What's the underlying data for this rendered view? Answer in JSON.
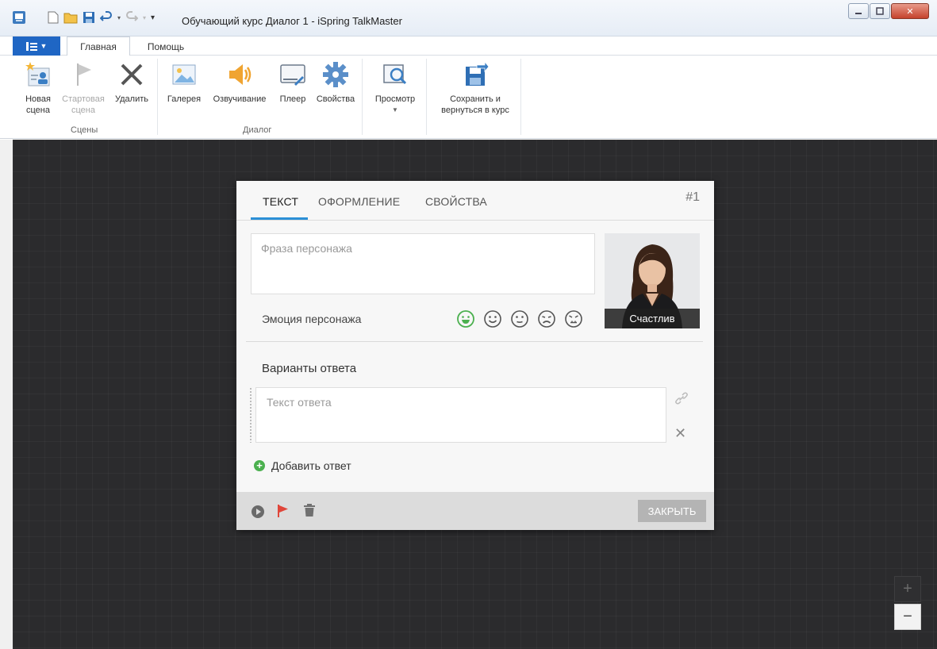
{
  "window": {
    "title": "Обучающий курс Диалог 1 - iSpring TalkMaster",
    "buttons": [
      "minimize",
      "maximize",
      "close"
    ]
  },
  "quick_access": [
    "new-file-icon",
    "open-folder-icon",
    "save-icon",
    "undo-icon",
    "redo-icon",
    "customize-icon"
  ],
  "ribbon": {
    "tabs": [
      {
        "label": "Главная",
        "active": true
      },
      {
        "label": "Помощь",
        "active": false
      }
    ],
    "groups": [
      {
        "label": "Сцены",
        "buttons": [
          {
            "line1": "Новая",
            "line2": "сцена",
            "icon": "new-scene-icon",
            "enabled": true
          },
          {
            "line1": "Стартовая",
            "line2": "сцена",
            "icon": "flag-icon",
            "enabled": false
          },
          {
            "line1": "Удалить",
            "line2": "",
            "icon": "delete-x-icon",
            "enabled": true
          }
        ]
      },
      {
        "label": "Диалог",
        "buttons": [
          {
            "line1": "Галерея",
            "icon": "gallery-icon",
            "enabled": true
          },
          {
            "line1": "Озвучивание",
            "icon": "speaker-icon",
            "enabled": true
          },
          {
            "line1": "Плеер",
            "icon": "player-icon",
            "enabled": true
          },
          {
            "line1": "Свойства",
            "icon": "gear-icon",
            "enabled": true
          }
        ]
      },
      {
        "label": "",
        "buttons": [
          {
            "line1": "Просмотр",
            "icon": "preview-icon",
            "enabled": true
          }
        ]
      },
      {
        "label": "",
        "buttons": [
          {
            "line1": "Сохранить и",
            "line2": "вернуться в курс",
            "icon": "save-return-icon",
            "enabled": true
          }
        ]
      }
    ]
  },
  "card": {
    "tabs": [
      {
        "label": "ТЕКСТ",
        "active": true
      },
      {
        "label": "ОФОРМЛЕНИЕ",
        "active": false
      },
      {
        "label": "СВОЙСТВА",
        "active": false
      }
    ],
    "number": "#1",
    "phrase_placeholder": "Фраза персонажа",
    "emotion_label": "Эмоция персонажа",
    "emotions": [
      {
        "name": "happy",
        "selected": true
      },
      {
        "name": "smile",
        "selected": false
      },
      {
        "name": "neutral",
        "selected": false
      },
      {
        "name": "sad",
        "selected": false
      },
      {
        "name": "angry",
        "selected": false
      }
    ],
    "avatar_caption": "Счастлив",
    "answers_label": "Варианты ответа",
    "answer_placeholder": "Текст ответа",
    "add_answer": "Добавить ответ",
    "close_button": "ЗАКРЫТЬ"
  },
  "zoom": {
    "plus": "+",
    "minus": "−"
  },
  "colors": {
    "accent": "#2b8fd6",
    "file_button": "#1f66c4",
    "canvas": "#2b2b2d",
    "emotion_selected": "#4bb04f",
    "flag": "#e0463a"
  }
}
